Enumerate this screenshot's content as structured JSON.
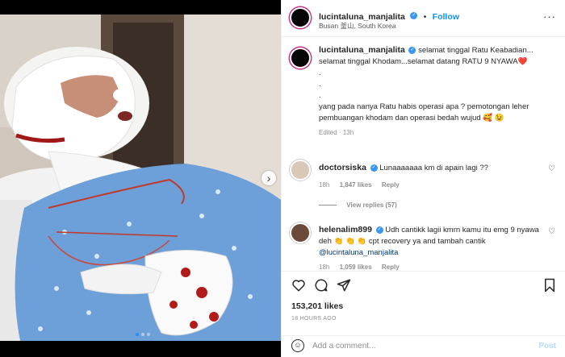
{
  "header": {
    "username": "lucintaluna_manjalita",
    "follow_label": "Follow",
    "location": "Busan 釜山, South Korea"
  },
  "caption": {
    "username": "lucintaluna_manjalita",
    "lines": [
      "selamat tinggal Ratu Keabadian...",
      "selamat tinggal Khodam...selamat datang RATU 9 NYAWA❤️",
      ".",
      ".",
      ".",
      "yang pada nanya Ratu habis operasi apa ? pemotongan leher",
      "pembuangan khodam dan operasi bedah wujud 🥰 😉"
    ],
    "meta": "Edited · 13h"
  },
  "comments": [
    {
      "username": "doctorsiska",
      "text": "Lunaaaaaaa km di apain lagi ??",
      "time": "18h",
      "likes": "1,847 likes",
      "reply": "Reply",
      "view_replies": "View replies (57)"
    },
    {
      "username": "helenalim899",
      "line1": "Udh cantikk lagii kmrn kamu itu emg 9 nyawa",
      "line2": "deh 👏 👏 👏 cpt recovery ya and tambah cantik",
      "mention": "@lucintaluna_manjalita",
      "time": "18h",
      "likes": "1,059 likes",
      "reply": "Reply"
    }
  ],
  "actions": {
    "likes": "153,201 likes",
    "time_ago": "18 HOURS AGO"
  },
  "comment_bar": {
    "placeholder": "Add a comment...",
    "post_label": "Post"
  },
  "carousel": {
    "current": 1,
    "total": 3
  },
  "icons": {
    "like": "heart-icon",
    "comment": "comment-icon",
    "share": "share-icon",
    "save": "bookmark-icon",
    "more": "more-options-icon"
  },
  "colors": {
    "accent": "#0095f6",
    "verified": "#3897f0"
  }
}
